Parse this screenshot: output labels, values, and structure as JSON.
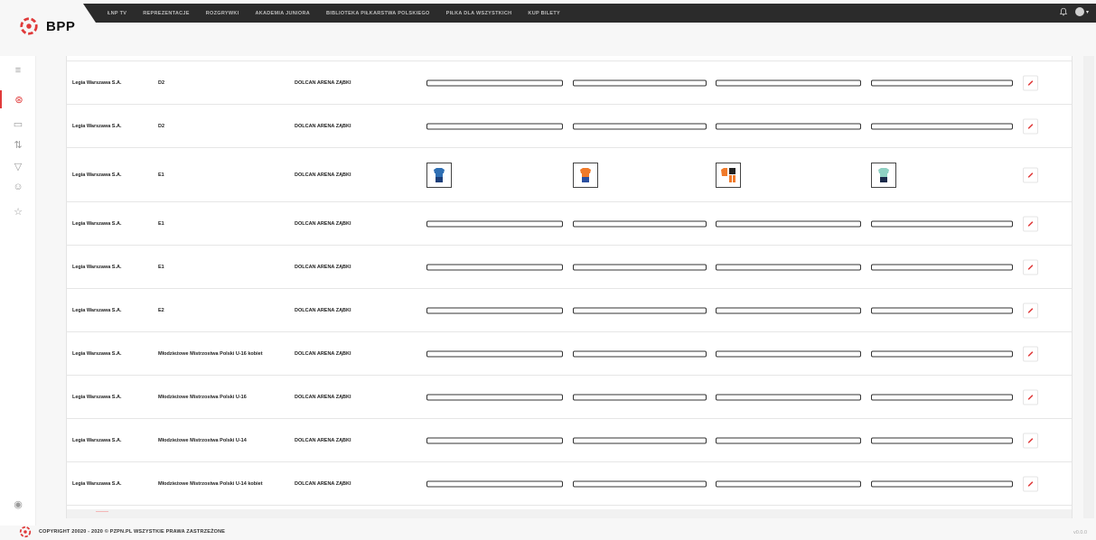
{
  "brand": {
    "name": "BPP",
    "accent": "#e03a3a"
  },
  "topnav": {
    "items": [
      "ŁNP TV",
      "REPREZENTACJE",
      "ROZGRYWKI",
      "AKADEMIA JUNIORA",
      "BIBLIOTEKA PIŁKARSTWA POLSKIEGO",
      "PIŁKA DLA WSZYSTKICH",
      "KUP BILETY"
    ],
    "icons": [
      "bell-icon",
      "user-avatar-icon"
    ]
  },
  "sidebar": {
    "items": [
      "menu-icon",
      "ball-icon",
      "box-icon",
      "sort-icon",
      "shirt-icon",
      "users-icon",
      "star-icon"
    ],
    "bottom": "user-circle-icon"
  },
  "rows": [
    {
      "club": "Legia Warszawa S.A.",
      "class": "D2",
      "stadium": "DOLCAN ARENA ZĄBKI",
      "kits": false
    },
    {
      "club": "Legia Warszawa S.A.",
      "class": "D2",
      "stadium": "DOLCAN ARENA ZĄBKI",
      "kits": false
    },
    {
      "club": "Legia Warszawa S.A.",
      "class": "E1",
      "stadium": "DOLCAN ARENA ZĄBKI",
      "kits": true
    },
    {
      "club": "Legia Warszawa S.A.",
      "class": "E1",
      "stadium": "DOLCAN ARENA ZĄBKI",
      "kits": false
    },
    {
      "club": "Legia Warszawa S.A.",
      "class": "E1",
      "stadium": "DOLCAN ARENA ZĄBKI",
      "kits": false
    },
    {
      "club": "Legia Warszawa S.A.",
      "class": "E2",
      "stadium": "DOLCAN ARENA ZĄBKI",
      "kits": false
    },
    {
      "club": "Legia Warszawa S.A.",
      "class": "Młodzieżowe Mistrzostwa Polski U-16 kobiet",
      "stadium": "DOLCAN ARENA ZĄBKI",
      "kits": false
    },
    {
      "club": "Legia Warszawa S.A.",
      "class": "Młodzieżowe Mistrzostwa Polski U-16",
      "stadium": "DOLCAN ARENA ZĄBKI",
      "kits": false
    },
    {
      "club": "Legia Warszawa S.A.",
      "class": "Młodzieżowe Mistrzostwa Polski U-14",
      "stadium": "DOLCAN ARENA ZĄBKI",
      "kits": false
    },
    {
      "club": "Legia Warszawa S.A.",
      "class": "Młodzieżowe Mistrzostwa Polski U-14 kobiet",
      "stadium": "DOLCAN ARENA ZĄBKI",
      "kits": false
    }
  ],
  "kit_colors": {
    "kit1": {
      "shirt": "#2f6fb3",
      "shorts": "#1c3f7a"
    },
    "kit2": {
      "shirt": "#f07a2a",
      "shorts": "#2a4fa0"
    },
    "kit3": {
      "shirt": "#f07a2a",
      "shorts": "#222222"
    },
    "kit4": {
      "shirt": "#8fd1c3",
      "shorts": "#1a2a4a"
    }
  },
  "footer": {
    "copyright": "COPYRIGHT 20020 - 2020 © PZPN.PL WSZYSTKIE PRAWA ZASTRZEŻONE",
    "version": "v0.0.0"
  }
}
